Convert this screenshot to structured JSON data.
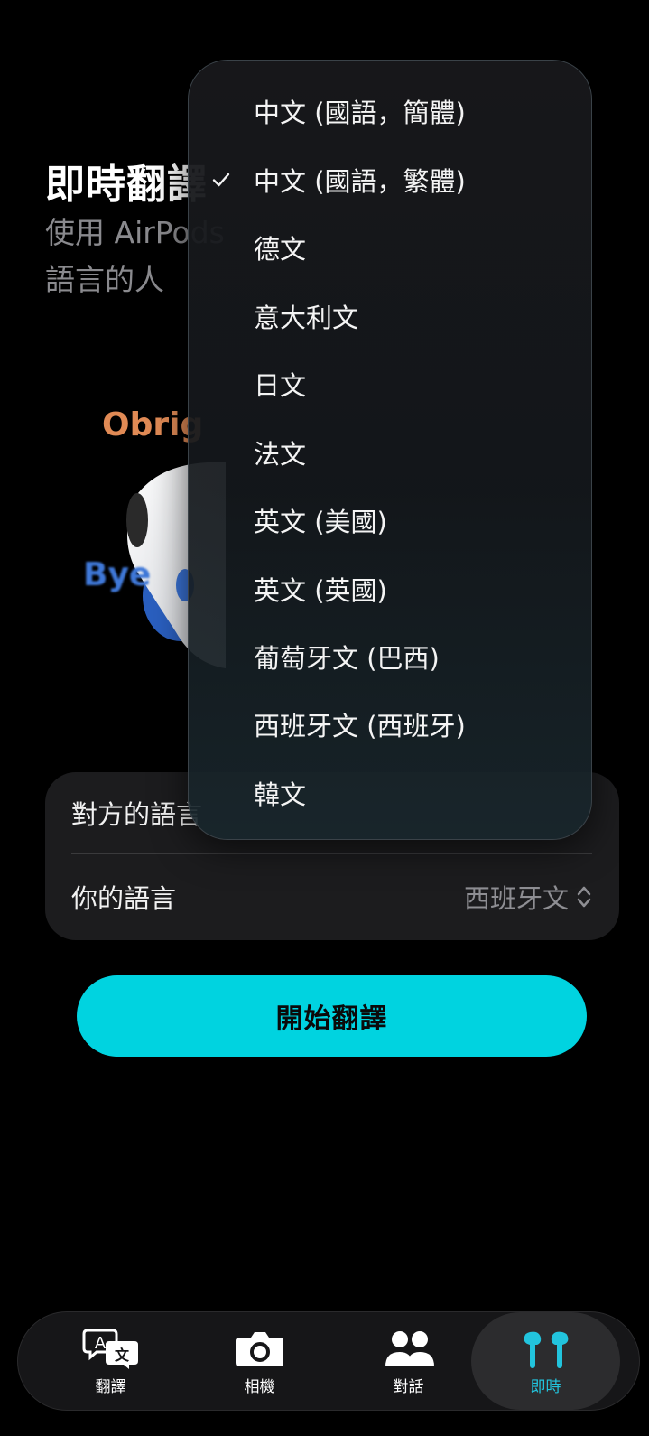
{
  "header": {
    "title": "即時翻譯",
    "subtitle_line1": "使用 AirPods",
    "subtitle_line2": "語言的人"
  },
  "illustration": {
    "word_top": "Obrig",
    "word_bottom": "Bye"
  },
  "language_menu": {
    "items": [
      {
        "label": "中文 (國語，簡體)",
        "checked": false
      },
      {
        "label": "中文 (國語，繁體)",
        "checked": true
      },
      {
        "label": "德文",
        "checked": false
      },
      {
        "label": "意大利文",
        "checked": false
      },
      {
        "label": "日文",
        "checked": false
      },
      {
        "label": "法文",
        "checked": false
      },
      {
        "label": "英文 (美國)",
        "checked": false
      },
      {
        "label": "英文 (英國)",
        "checked": false
      },
      {
        "label": "葡萄牙文 (巴西)",
        "checked": false
      },
      {
        "label": "西班牙文 (西班牙)",
        "checked": false
      },
      {
        "label": "韓文",
        "checked": false
      }
    ]
  },
  "settings": {
    "other_language_label": "對方的語言",
    "your_language_label": "你的語言",
    "your_language_value": "西班牙文"
  },
  "start_button_label": "開始翻譯",
  "tabs": [
    {
      "label": "翻譯",
      "icon": "translate-icon",
      "active": false
    },
    {
      "label": "相機",
      "icon": "camera-icon",
      "active": false
    },
    {
      "label": "對話",
      "icon": "people-icon",
      "active": false
    },
    {
      "label": "即時",
      "icon": "airpods-icon",
      "active": true
    }
  ],
  "colors": {
    "accent": "#00d3e0",
    "active_tab": "#22c4dd",
    "orange_word": "#e08a55",
    "blue_word": "#3f78d8"
  }
}
